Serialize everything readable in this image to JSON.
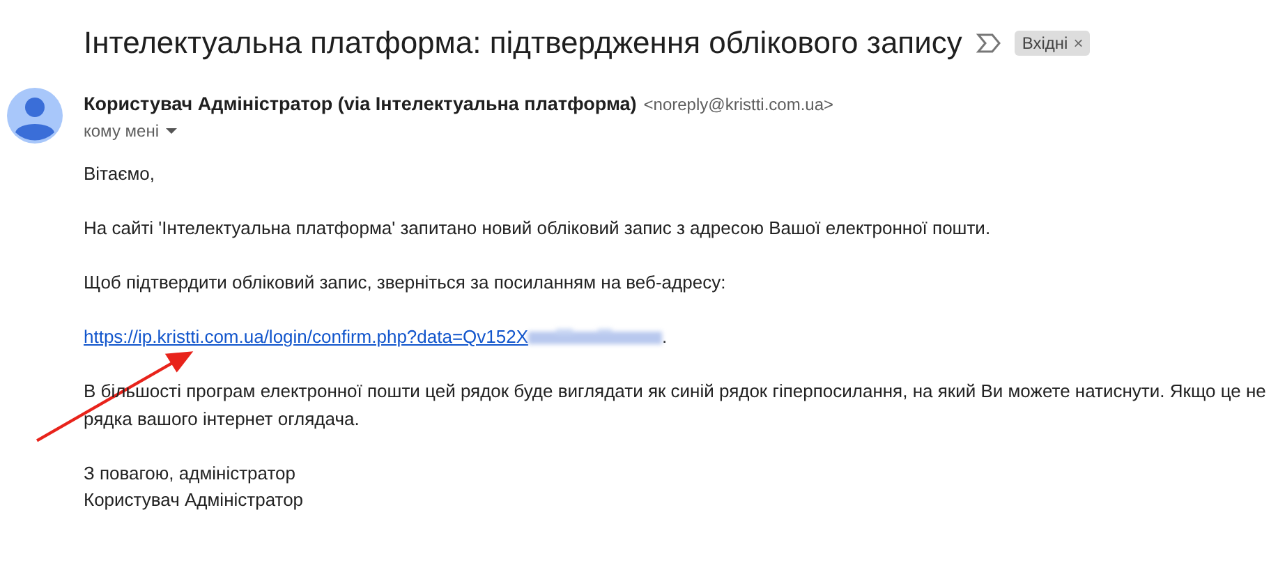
{
  "subject": "Інтелектуальна платформа: підтвердження облікового запису",
  "label": {
    "text": "Вхідні",
    "close": "×"
  },
  "sender": {
    "name": "Користувач Адміністратор (via Інтелектуальна платформа)",
    "email": "<noreply@kristti.com.ua>",
    "recipient": "кому мені"
  },
  "body": {
    "greeting": "Вітаємо,",
    "paragraph_1": "На сайті 'Інтелектуальна платформа' запитано новий обліковий запис з адресою Вашої електронної пошти.",
    "paragraph_2": "Щоб підтвердити обліковий запис, зверніться за посиланням на веб-адресу:",
    "link": "https://ip.kristti.com.ua/login/confirm.php?data=Qv152X",
    "link_end": ".",
    "paragraph_3": [
      "В більшості програм електронної пошти цей рядок буде виглядати як синій рядок гіперпосилання, на який Ви можете натиснути. Якщо це не",
      "рядка вашого інтернет оглядача."
    ],
    "closing": "З повагою, адміністратор",
    "signature": "Користувач Адміністратор"
  }
}
